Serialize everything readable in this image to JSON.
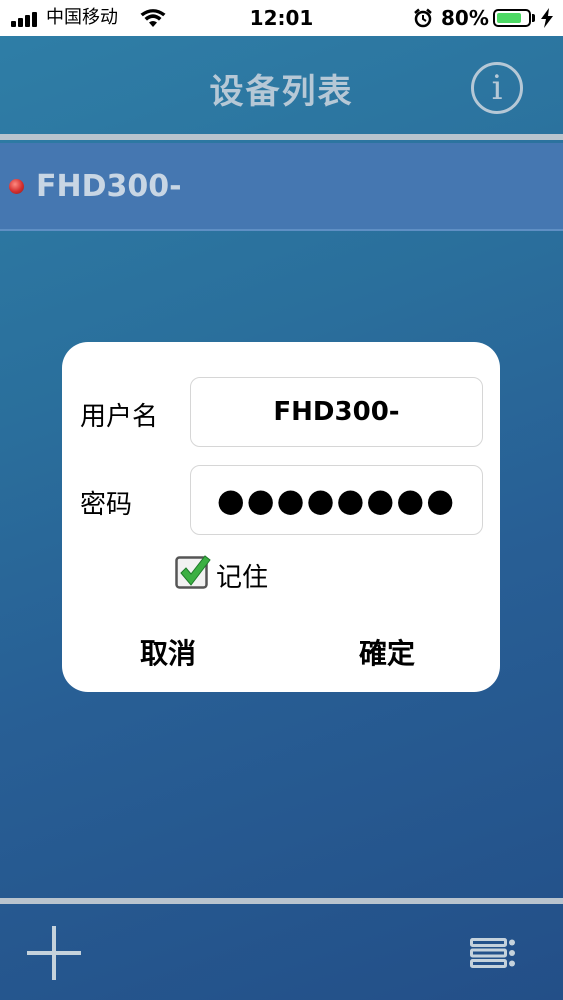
{
  "status_bar": {
    "carrier": "中国移动",
    "time": "12:01",
    "battery_percent": "80%",
    "battery_level": 0.8,
    "icons": [
      "signal-icon",
      "wifi-icon",
      "alarm-icon",
      "battery-icon",
      "charging-bolt-icon"
    ]
  },
  "nav": {
    "title": "设备列表",
    "info_icon": "info-icon",
    "info_glyph": "i"
  },
  "devices": [
    {
      "name": "FHD300-",
      "status_color": "#d32f2f"
    }
  ],
  "login_dialog": {
    "username_label": "用户名",
    "username_value": "FHD300-",
    "password_label": "密码",
    "password_value": "●●●●●●●●",
    "remember_label": "记住",
    "remember_checked": true,
    "cancel_label": "取消",
    "confirm_label": "確定"
  },
  "toolbar": {
    "add_icon": "plus-icon",
    "menu_icon": "list-settings-icon"
  },
  "colors": {
    "background_top": "#2f7fa7",
    "background_bottom": "#234f88",
    "selected_row": "#4577b1",
    "nav_text": "#b6c8d6",
    "battery_fill": "#4cd964"
  }
}
